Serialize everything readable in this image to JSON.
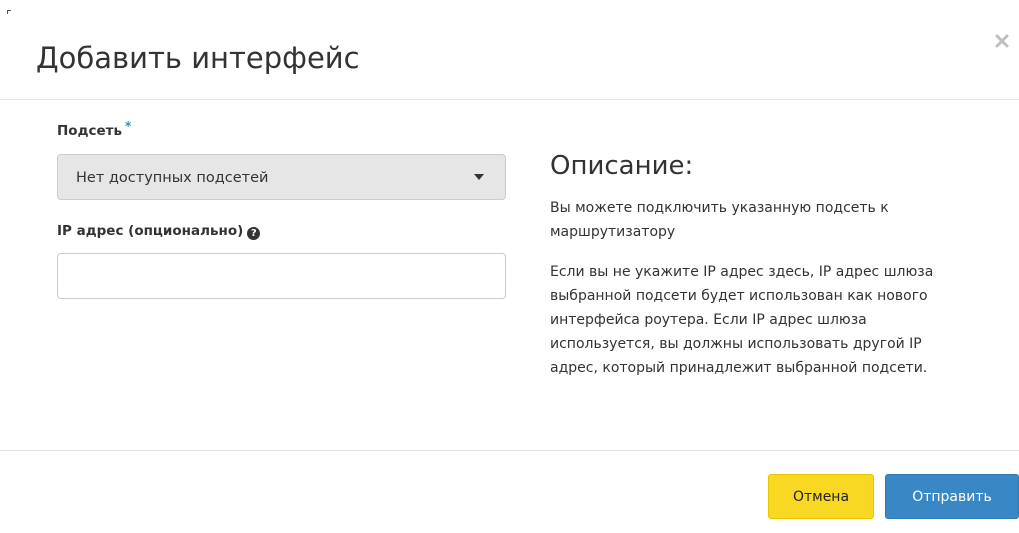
{
  "dialog": {
    "title": "Добавить интерфейс",
    "close_icon": "close-icon"
  },
  "form": {
    "subnet": {
      "label": "Подсеть",
      "required_mark": "*",
      "selected_value": "Нет доступных подсетей",
      "disabled": true
    },
    "ip_address": {
      "label": "IP адрес (опционально)",
      "help_icon": "question-circle-icon",
      "value": "",
      "placeholder": ""
    }
  },
  "description": {
    "heading": "Описание:",
    "paragraph_1": "Вы можете подключить указанную подсеть к маршрутизатору",
    "paragraph_2": "Если вы не укажите IP адрес здесь, IP адрес шлюза выбранной подсети будет использован как нового интерфейса роутера. Если IP адрес шлюза используется, вы должны использовать другой IP адрес, который принадлежит выбранной подсети."
  },
  "footer": {
    "cancel_label": "Отмена",
    "submit_label": "Отправить"
  },
  "colors": {
    "cancel_button": "#f9d823",
    "submit_button": "#3a87c6",
    "required_mark": "#3a87c6",
    "select_disabled_bg": "#e6e6e6"
  }
}
